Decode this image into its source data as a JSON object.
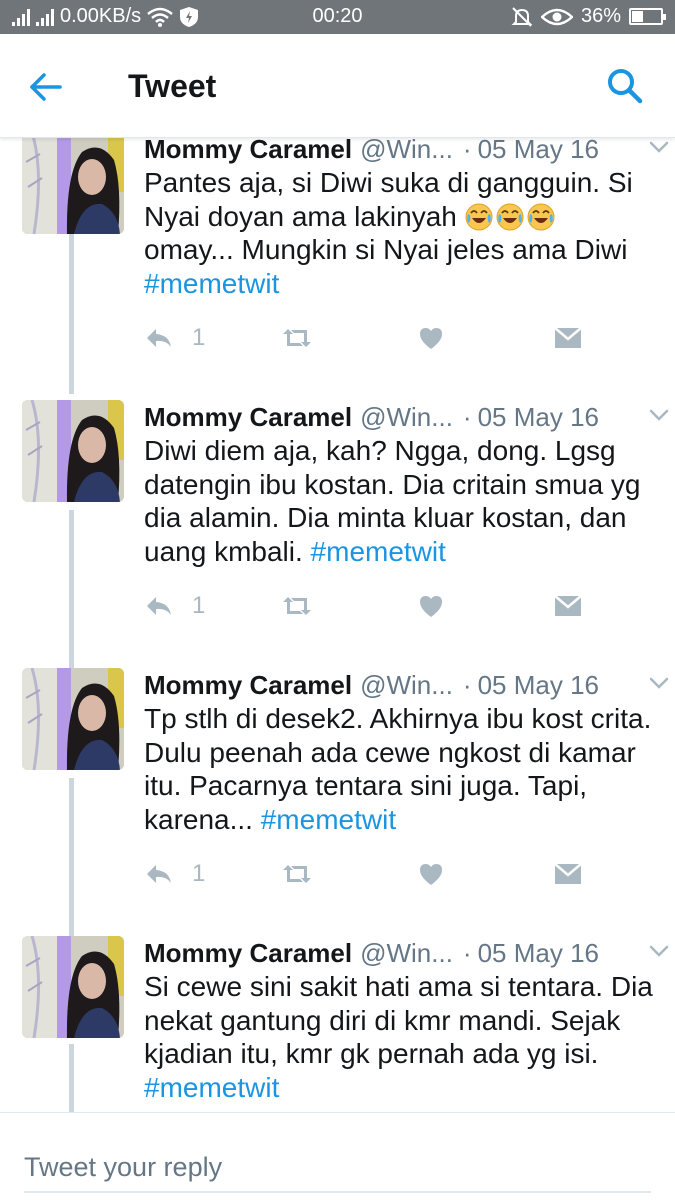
{
  "status_bar": {
    "network_speed": "0.00KB/s",
    "time": "00:20",
    "battery": "36%"
  },
  "header": {
    "title": "Tweet",
    "back_icon": "arrow-left-icon",
    "search_icon": "search-icon"
  },
  "colors": {
    "accent": "#1b95e0",
    "muted": "#657786",
    "icon_gray": "#aab8c2",
    "thread_line": "#ccd6dd"
  },
  "tweets": [
    {
      "name": "Mommy Caramel",
      "handle": "@Win...",
      "separator": "·",
      "date": "05 May 16",
      "text_parts": [
        "Pantes aja, si Diwi suka di gangguin. Si Nyai doyan ama lakinyah ",
        " omay... Mungkin si Nyai jeles ama Diwi "
      ],
      "emoji": "face-with-tears-of-joy x3",
      "hashtag": "#memetwit",
      "reply_count": "1"
    },
    {
      "name": "Mommy Caramel",
      "handle": "@Win...",
      "separator": "·",
      "date": "05 May 16",
      "text": "Diwi diem aja, kah? Ngga, dong. Lgsg datengin ibu kostan. Dia critain smua yg dia alamin. Dia minta kluar kostan, dan uang kmbali. ",
      "hashtag": "#memetwit",
      "reply_count": "1"
    },
    {
      "name": "Mommy Caramel",
      "handle": "@Win...",
      "separator": "·",
      "date": "05 May 16",
      "text": "Tp stlh di desek2. Akhirnya ibu kost crita. Dulu peenah ada cewe ngkost di kamar itu. Pacarnya tentara sini juga. Tapi, karena... ",
      "hashtag": "#memetwit",
      "reply_count": "1"
    },
    {
      "name": "Mommy Caramel",
      "handle": "@Win...",
      "separator": "·",
      "date": "05 May 16",
      "text": "Si cewe sini sakit hati ama si tentara. Dia nekat gantung diri di kmr mandi. Sejak kjadian itu, kmr gk pernah ada yg isi. ",
      "hashtag": "#memetwit"
    }
  ],
  "reply_bar": {
    "placeholder": "Tweet your reply"
  }
}
